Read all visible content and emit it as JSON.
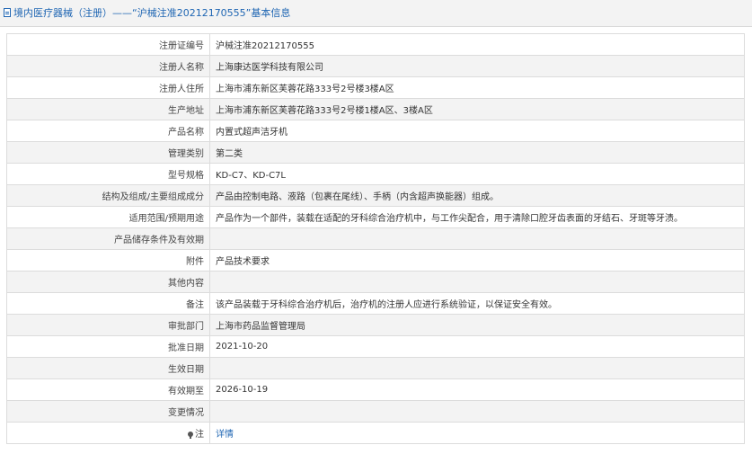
{
  "header": {
    "title": "境内医疗器械（注册）——“沪械注准20212170555”基本信息"
  },
  "rows": [
    {
      "label": "注册证编号",
      "value": "沪械注准20212170555"
    },
    {
      "label": "注册人名称",
      "value": "上海康达医学科技有限公司"
    },
    {
      "label": "注册人住所",
      "value": "上海市浦东新区芙蓉花路333号2号楼3楼A区"
    },
    {
      "label": "生产地址",
      "value": "上海市浦东新区芙蓉花路333号2号楼1楼A区、3楼A区"
    },
    {
      "label": "产品名称",
      "value": "内置式超声洁牙机"
    },
    {
      "label": "管理类别",
      "value": "第二类"
    },
    {
      "label": "型号规格",
      "value": "KD-C7、KD-C7L"
    },
    {
      "label": "结构及组成/主要组成成分",
      "value": "产品由控制电路、液路（包裹在尾线）、手柄（内含超声换能器）组成。"
    },
    {
      "label": "适用范围/预期用途",
      "value": "产品作为一个部件，装载在适配的牙科综合治疗机中，与工作尖配合，用于清除口腔牙齿表面的牙结石、牙斑等牙渍。"
    },
    {
      "label": "产品储存条件及有效期",
      "value": ""
    },
    {
      "label": "附件",
      "value": "产品技术要求"
    },
    {
      "label": "其他内容",
      "value": ""
    },
    {
      "label": "备注",
      "value": "该产品装载于牙科综合治疗机后，治疗机的注册人应进行系统验证，以保证安全有效。"
    },
    {
      "label": "审批部门",
      "value": "上海市药品监督管理局"
    },
    {
      "label": "批准日期",
      "value": "2021-10-20"
    },
    {
      "label": "生效日期",
      "value": ""
    },
    {
      "label": "有效期至",
      "value": "2026-10-19"
    },
    {
      "label": "变更情况",
      "value": ""
    }
  ],
  "note_row": {
    "label": "注",
    "link_text": "详情",
    "icon": "pin-icon"
  }
}
